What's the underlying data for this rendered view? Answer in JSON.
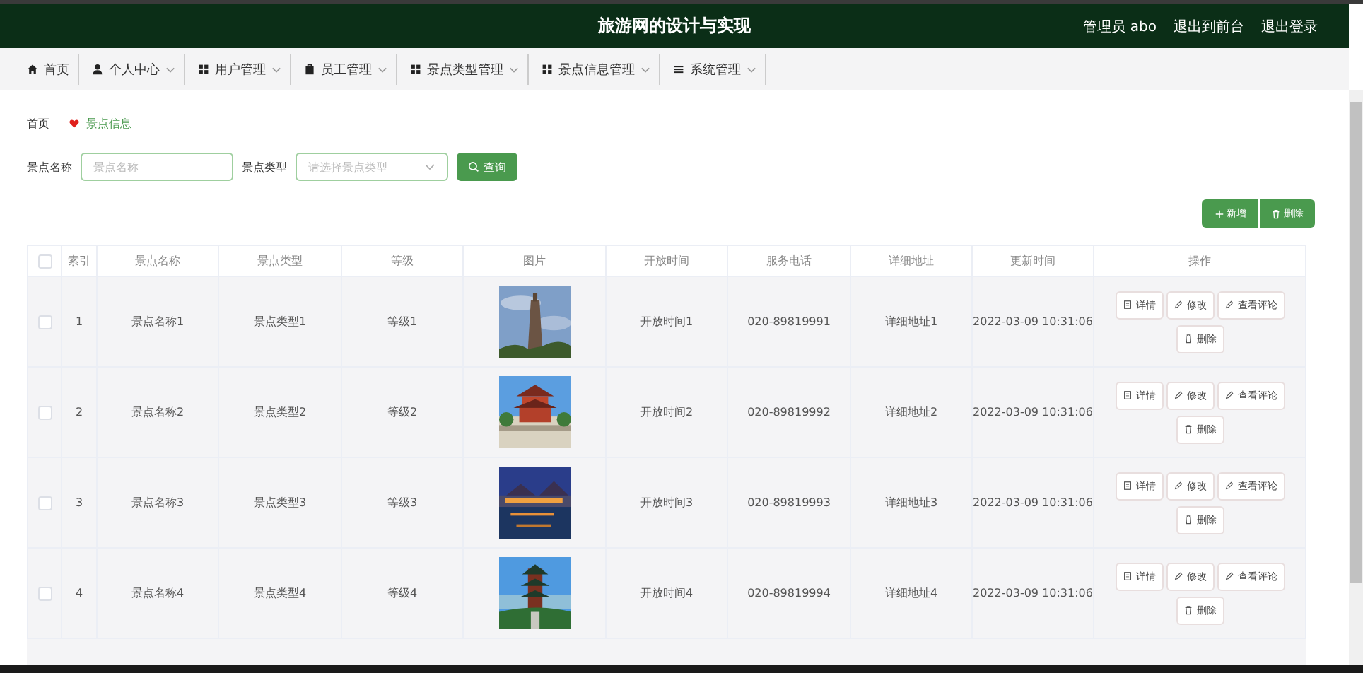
{
  "header": {
    "title": "旅游网的设计与实现",
    "links": [
      "管理员 abo",
      "退出到前台",
      "退出登录"
    ]
  },
  "nav": [
    {
      "label": "首页",
      "dropdown": false
    },
    {
      "label": "个人中心",
      "dropdown": true
    },
    {
      "label": "用户管理",
      "dropdown": true
    },
    {
      "label": "员工管理",
      "dropdown": true
    },
    {
      "label": "景点类型管理",
      "dropdown": true
    },
    {
      "label": "景点信息管理",
      "dropdown": true
    },
    {
      "label": "系统管理",
      "dropdown": true
    }
  ],
  "breadcrumb": [
    "首页",
    "景点信息"
  ],
  "search": [
    {
      "kind": "input",
      "label": "景点名称",
      "placeholder": "景点名称"
    },
    {
      "kind": "select",
      "label": "景点类型",
      "placeholder": "请选择景点类型"
    }
  ],
  "search_button": "查询",
  "actions": [
    {
      "kind": "add",
      "label": "新增"
    },
    {
      "kind": "delete",
      "label": "删除"
    }
  ],
  "table": {
    "select_all": {
      "checked": false
    },
    "columns": [
      "索引",
      "景点名称",
      "景点类型",
      "等级",
      "图片",
      "开放时间",
      "服务电话",
      "详细地址",
      "更新时间",
      "操作"
    ],
    "rows": [
      {
        "checked": false,
        "index": "1",
        "name": "景点名称1",
        "type": "景点类型1",
        "level": "等级1",
        "open": "开放时间1",
        "phone": "020-89819991",
        "address": "详细地址1",
        "updated": "2022-03-09 10:31:06",
        "ops": [
          "详情",
          "修改",
          "查看评论",
          "删除"
        ]
      },
      {
        "checked": false,
        "index": "2",
        "name": "景点名称2",
        "type": "景点类型2",
        "level": "等级2",
        "open": "开放时间2",
        "phone": "020-89819992",
        "address": "详细地址2",
        "updated": "2022-03-09 10:31:06",
        "ops": [
          "详情",
          "修改",
          "查看评论",
          "删除"
        ]
      },
      {
        "checked": false,
        "index": "3",
        "name": "景点名称3",
        "type": "景点类型3",
        "level": "等级3",
        "open": "开放时间3",
        "phone": "020-89819993",
        "address": "详细地址3",
        "updated": "2022-03-09 10:31:06",
        "ops": [
          "详情",
          "修改",
          "查看评论",
          "删除"
        ]
      },
      {
        "checked": false,
        "index": "4",
        "name": "景点名称4",
        "type": "景点类型4",
        "level": "等级4",
        "open": "开放时间4",
        "phone": "020-89819994",
        "address": "详细地址4",
        "updated": "2022-03-09 10:31:06",
        "ops": [
          "详情",
          "修改",
          "查看评论",
          "删除"
        ]
      }
    ]
  }
}
